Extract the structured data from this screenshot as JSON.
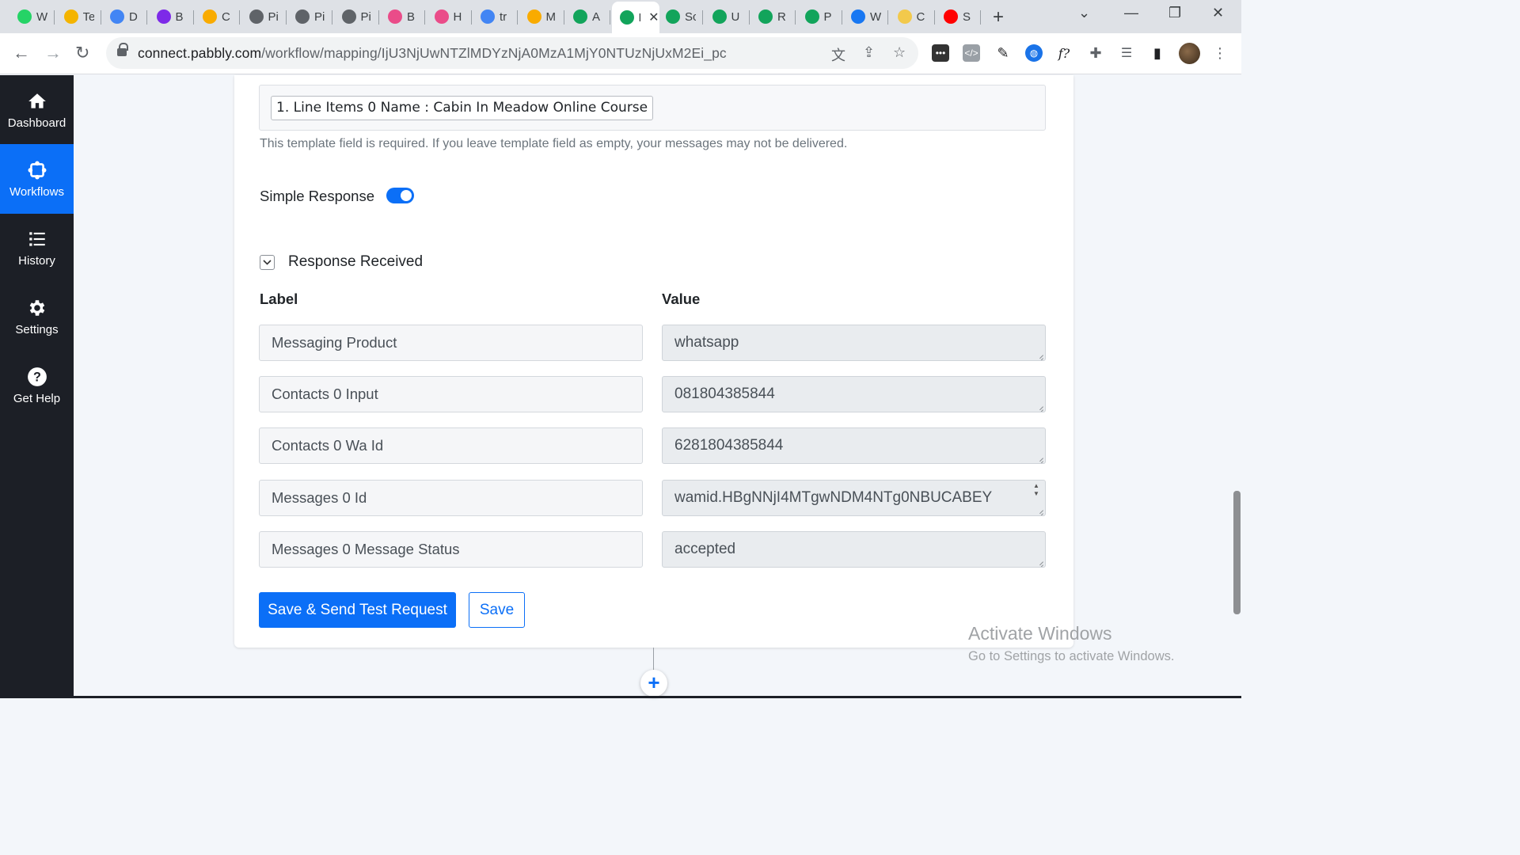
{
  "browser": {
    "tabs": [
      {
        "icon": "whatsapp-icon",
        "label": "W",
        "color": "#25d366"
      },
      {
        "icon": "google-drive-icon",
        "label": "Te",
        "color": "#f4b400"
      },
      {
        "icon": "google-docs-icon",
        "label": "D",
        "color": "#4285f4"
      },
      {
        "icon": "canva-icon",
        "label": "B",
        "color": "#7d2ae8"
      },
      {
        "icon": "analytics-icon",
        "label": "C",
        "color": "#f9ab00"
      },
      {
        "icon": "globe-icon",
        "label": "Pi",
        "color": "#5f6368"
      },
      {
        "icon": "globe-icon",
        "label": "Pi",
        "color": "#5f6368"
      },
      {
        "icon": "globe-icon",
        "label": "Pi",
        "color": "#5f6368"
      },
      {
        "icon": "dribbble-icon",
        "label": "B",
        "color": "#ea4c89"
      },
      {
        "icon": "dribbble-icon",
        "label": "H",
        "color": "#ea4c89"
      },
      {
        "icon": "google-icon",
        "label": "tr",
        "color": "#4285f4"
      },
      {
        "icon": "analytics-icon",
        "label": "M",
        "color": "#f9ab00"
      },
      {
        "icon": "pabbly-icon",
        "label": "A",
        "color": "#12a45b"
      },
      {
        "icon": "pabbly-icon",
        "label": "Pc",
        "color": "#12a45b",
        "active": true
      },
      {
        "icon": "pabbly-icon",
        "label": "Sc",
        "color": "#12a45b"
      },
      {
        "icon": "pabbly-icon",
        "label": "U",
        "color": "#12a45b"
      },
      {
        "icon": "pabbly-icon",
        "label": "R",
        "color": "#12a45b"
      },
      {
        "icon": "pabbly-icon",
        "label": "P",
        "color": "#12a45b"
      },
      {
        "icon": "facebook-icon",
        "label": "W",
        "color": "#1877f2"
      },
      {
        "icon": "crown-icon",
        "label": "C",
        "color": "#f2c94c"
      },
      {
        "icon": "youtube-icon",
        "label": "S",
        "color": "#ff0000"
      }
    ],
    "url_host": "connect.pabbly.com",
    "url_path": "/workflow/mapping/IjU3NjUwNTZlMDYzNjA0MzA1MjY0NTUzNjUxM2Ei_pc"
  },
  "sidebar": {
    "items": [
      {
        "label": "Dashboard",
        "icon": "home-icon",
        "active": false
      },
      {
        "label": "Workflows",
        "icon": "workflow-icon",
        "active": true
      },
      {
        "label": "History",
        "icon": "history-list-icon",
        "active": false
      },
      {
        "label": "Settings",
        "icon": "gear-icon",
        "active": false
      },
      {
        "label": "Get Help",
        "icon": "help-icon",
        "active": false
      }
    ]
  },
  "main": {
    "template_chip": "1. Line Items 0 Name : Cabin In Meadow Online Course",
    "template_help": "This template field is required. If you leave template field as empty, your messages may not be delivered.",
    "simple_response_label": "Simple Response",
    "simple_response_enabled": true,
    "response_section_title": "Response Received",
    "label_header": "Label",
    "value_header": "Value",
    "rows": [
      {
        "label": "Messaging Product",
        "value": "whatsapp"
      },
      {
        "label": "Contacts 0 Input",
        "value": "081804385844"
      },
      {
        "label": "Contacts 0 Wa Id",
        "value": "6281804385844"
      },
      {
        "label": "Messages 0 Id",
        "value": "wamid.HBgNNjI4MTgwNDM4NTg0NBUCABEY"
      },
      {
        "label": "Messages 0 Message Status",
        "value": "accepted"
      }
    ],
    "save_send_label": "Save & Send Test Request",
    "save_label": "Save"
  },
  "watermark": {
    "line1": "Activate Windows",
    "line2": "Go to Settings to activate Windows."
  },
  "colors": {
    "primary": "#0b6ff7",
    "sidebar_bg": "#1c1f26"
  }
}
